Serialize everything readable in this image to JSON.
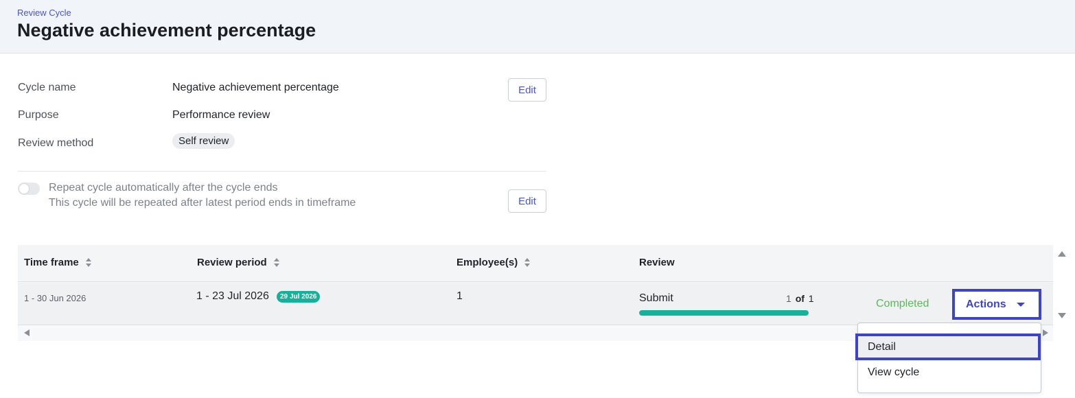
{
  "header": {
    "breadcrumb": "Review Cycle",
    "title": "Negative achievement percentage"
  },
  "details": {
    "cycle_name_label": "Cycle name",
    "cycle_name_value": "Negative achievement percentage",
    "purpose_label": "Purpose",
    "purpose_value": "Performance review",
    "review_method_label": "Review method",
    "review_method_value": "Self review",
    "edit_label": "Edit"
  },
  "repeat": {
    "enabled": false,
    "title": "Repeat cycle automatically after the cycle ends",
    "description": "This cycle will be repeated after latest period ends in timeframe",
    "edit_label": "Edit"
  },
  "table": {
    "columns": [
      "Time frame",
      "Review period",
      "Employee(s)",
      "Review"
    ],
    "rows": [
      {
        "time_frame": "1 - 30 Jun 2026",
        "review_period": "1 - 23 Jul 2026",
        "period_badge": "29 Jul 2026",
        "employees": "1",
        "review_label": "Submit",
        "review_done": "1",
        "review_of": "of",
        "review_total": "1",
        "progress": 1.0,
        "status": "Completed",
        "actions_label": "Actions"
      }
    ]
  },
  "dropdown": {
    "items": [
      "Detail",
      "View cycle"
    ]
  },
  "colors": {
    "accent": "#3d44c9",
    "teal": "#14b29a",
    "completed": "#5cb85c"
  }
}
